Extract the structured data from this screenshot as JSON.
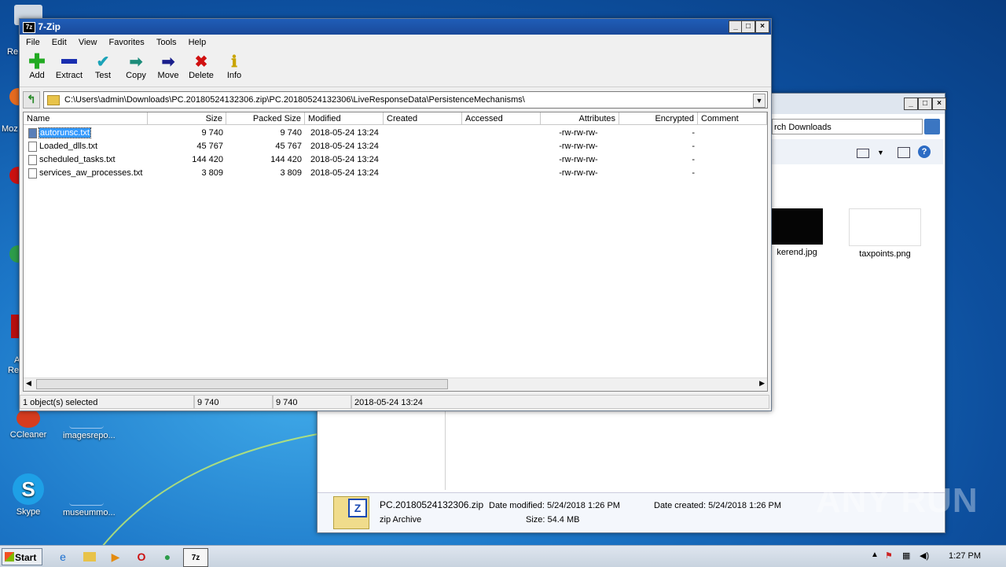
{
  "desktop": {
    "icons": [
      {
        "label": "CCleaner"
      },
      {
        "label": "imagesrepo..."
      },
      {
        "label": "Skype"
      },
      {
        "label": "museummo..."
      }
    ],
    "edge_labels": [
      "Re",
      "Moz",
      "A",
      "Re"
    ]
  },
  "explorer": {
    "search_text": "rch Downloads",
    "thumbs": [
      {
        "label": "kerend.jpg"
      },
      {
        "label": "taxpoints.png"
      }
    ],
    "details": {
      "filename": "PC.20180524132306.zip",
      "type": "zip Archive",
      "date_modified": "Date modified: 5/24/2018 1:26 PM",
      "date_created": "Date created: 5/24/2018 1:26 PM",
      "size": "Size: 54.4 MB"
    }
  },
  "sevenzip": {
    "title": "7-Zip",
    "menu": [
      "File",
      "Edit",
      "View",
      "Favorites",
      "Tools",
      "Help"
    ],
    "toolbar": [
      {
        "label": "Add",
        "icon": "add-icon",
        "color": "#22aa22"
      },
      {
        "label": "Extract",
        "icon": "extract-icon",
        "color": "#1a2fb0"
      },
      {
        "label": "Test",
        "icon": "test-icon",
        "color": "#1ba3b8"
      },
      {
        "label": "Copy",
        "icon": "copy-icon",
        "color": "#1c8c7a"
      },
      {
        "label": "Move",
        "icon": "move-icon",
        "color": "#1a1f8c"
      },
      {
        "label": "Delete",
        "icon": "delete-icon",
        "color": "#d01010"
      },
      {
        "label": "Info",
        "icon": "info-icon",
        "color": "#c9a400"
      }
    ],
    "path": "C:\\Users\\admin\\Downloads\\PC.20180524132306.zip\\PC.20180524132306\\LiveResponseData\\PersistenceMechanisms\\",
    "columns": [
      "Name",
      "Size",
      "Packed Size",
      "Modified",
      "Created",
      "Accessed",
      "Attributes",
      "Encrypted",
      "Comment"
    ],
    "files": [
      {
        "name": "autorunsc.txt",
        "size": "9 740",
        "packed": "9 740",
        "modified": "2018-05-24 13:24",
        "attributes": "-rw-rw-rw-",
        "encrypted": "-",
        "selected": true
      },
      {
        "name": "Loaded_dlls.txt",
        "size": "45 767",
        "packed": "45 767",
        "modified": "2018-05-24 13:24",
        "attributes": "-rw-rw-rw-",
        "encrypted": "-",
        "selected": false
      },
      {
        "name": "scheduled_tasks.txt",
        "size": "144 420",
        "packed": "144 420",
        "modified": "2018-05-24 13:24",
        "attributes": "-rw-rw-rw-",
        "encrypted": "-",
        "selected": false
      },
      {
        "name": "services_aw_processes.txt",
        "size": "3 809",
        "packed": "3 809",
        "modified": "2018-05-24 13:24",
        "attributes": "-rw-rw-rw-",
        "encrypted": "-",
        "selected": false
      }
    ],
    "status": {
      "selected": "1 object(s) selected",
      "size": "9 740",
      "packed": "9 740",
      "modified": "2018-05-24 13:24"
    }
  },
  "taskbar": {
    "start_label": "Start",
    "clock": "1:27 PM"
  },
  "watermark": "ANY RUN"
}
